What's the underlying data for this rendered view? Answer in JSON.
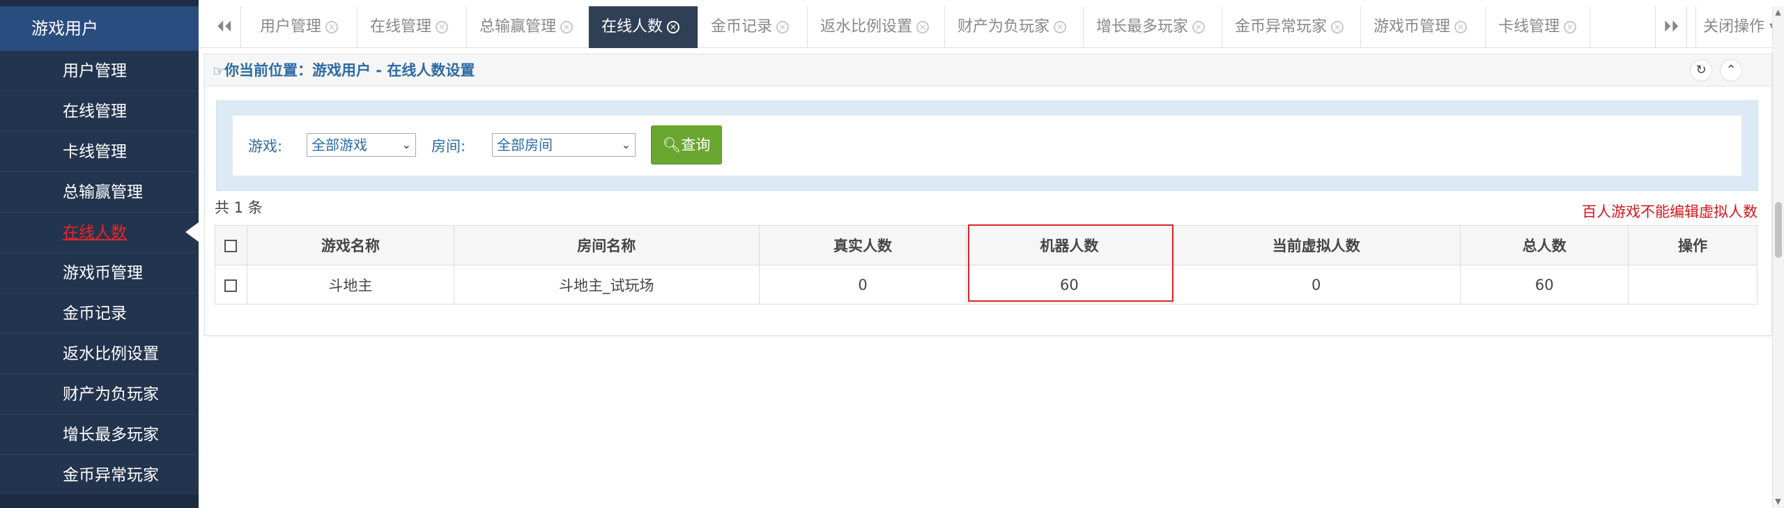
{
  "sidebar": {
    "title": "游戏用户",
    "items": [
      {
        "label": "用户管理"
      },
      {
        "label": "在线管理"
      },
      {
        "label": "卡线管理"
      },
      {
        "label": "总输赢管理"
      },
      {
        "label": "在线人数",
        "active": true
      },
      {
        "label": "游戏币管理"
      },
      {
        "label": "金币记录"
      },
      {
        "label": "返水比例设置"
      },
      {
        "label": "财产为负玩家"
      },
      {
        "label": "增长最多玩家"
      },
      {
        "label": "金币异常玩家"
      }
    ]
  },
  "tabs": {
    "items": [
      {
        "label": "用户管理"
      },
      {
        "label": "在线管理"
      },
      {
        "label": "总输赢管理"
      },
      {
        "label": "在线人数",
        "active": true
      },
      {
        "label": "金币记录"
      },
      {
        "label": "返水比例设置"
      },
      {
        "label": "财产为负玩家"
      },
      {
        "label": "增长最多玩家"
      },
      {
        "label": "金币异常玩家"
      },
      {
        "label": "游戏币管理"
      },
      {
        "label": "卡线管理"
      }
    ],
    "close_ops": "关闭操作"
  },
  "breadcrumb": "你当前位置：游戏用户 - 在线人数设置",
  "filter": {
    "game_label": "游戏:",
    "game_value": "全部游戏",
    "room_label": "房间:",
    "room_value": "全部房间",
    "query_label": "查询"
  },
  "count_text": "共 1 条",
  "note_text": "百人游戏不能编辑虚拟人数",
  "table": {
    "headers": [
      "游戏名称",
      "房间名称",
      "真实人数",
      "机器人数",
      "当前虚拟人数",
      "总人数",
      "操作"
    ],
    "rows": [
      [
        "斗地主",
        "斗地主_试玩场",
        "0",
        "60",
        "0",
        "60",
        ""
      ]
    ]
  },
  "colors": {
    "sidebar_bg": "#23344e",
    "sidebar_title_bg": "#2a4d7f",
    "active_tab_bg": "#2f4056",
    "accent_blue": "#2b6aa3",
    "query_green": "#6aa731",
    "alert_red": "#d4161c"
  }
}
